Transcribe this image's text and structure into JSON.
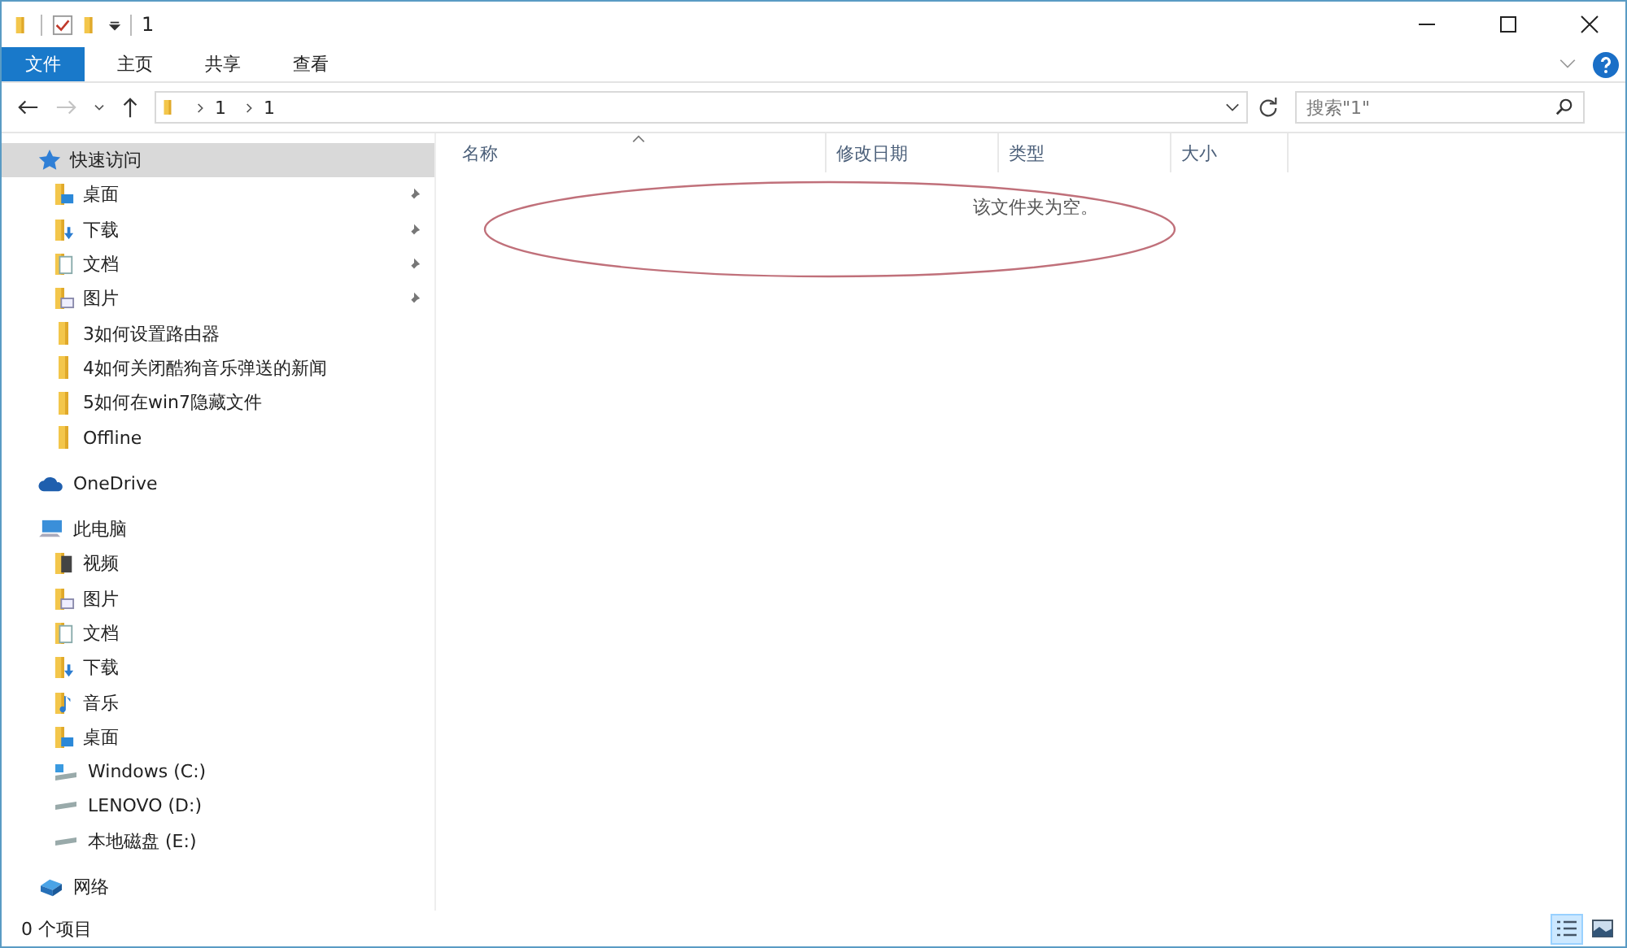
{
  "window": {
    "title": "1"
  },
  "ribbon": {
    "tabs": [
      {
        "label": "文件",
        "kind": "file"
      },
      {
        "label": "主页",
        "kind": "tab"
      },
      {
        "label": "共享",
        "kind": "tab"
      },
      {
        "label": "查看",
        "kind": "tab"
      }
    ]
  },
  "navigation": {
    "forward_disabled": true,
    "path": [
      "1",
      "1"
    ],
    "search": {
      "placeholder": "搜索\"1\""
    }
  },
  "sidebar": {
    "items": [
      {
        "label": "快速访问",
        "kind": "star",
        "selected": true,
        "children": [
          {
            "label": "桌面",
            "kind": "desktop",
            "pinned": true,
            "selected": false
          },
          {
            "label": "下载",
            "kind": "download",
            "pinned": true,
            "selected": false
          },
          {
            "label": "文档",
            "kind": "document",
            "pinned": true,
            "selected": false
          },
          {
            "label": "图片",
            "kind": "pictures",
            "pinned": true,
            "selected": false
          },
          {
            "label": "3如何设置路由器",
            "kind": "folder",
            "pinned": false,
            "selected": false
          },
          {
            "label": "4如何关闭酷狗音乐弹送的新闻",
            "kind": "folder",
            "pinned": false,
            "selected": false
          },
          {
            "label": "5如何在win7隐藏文件",
            "kind": "folder",
            "pinned": false,
            "selected": false
          },
          {
            "label": "Offline",
            "kind": "folder",
            "pinned": false,
            "selected": false
          }
        ]
      },
      {
        "label": "OneDrive",
        "kind": "cloud",
        "selected": false
      },
      {
        "label": "此电脑",
        "kind": "computer",
        "selected": false,
        "children": [
          {
            "label": "视频",
            "kind": "video",
            "pinned": false,
            "selected": false
          },
          {
            "label": "图片",
            "kind": "pictures",
            "pinned": false,
            "selected": false
          },
          {
            "label": "文档",
            "kind": "document",
            "pinned": false,
            "selected": false
          },
          {
            "label": "下载",
            "kind": "download",
            "pinned": false,
            "selected": false
          },
          {
            "label": "音乐",
            "kind": "music",
            "pinned": false,
            "selected": false
          },
          {
            "label": "桌面",
            "kind": "desktop",
            "pinned": false,
            "selected": false
          },
          {
            "label": "Windows (C:)",
            "kind": "system-drive",
            "pinned": false,
            "selected": false
          },
          {
            "label": "LENOVO (D:)",
            "kind": "drive",
            "pinned": false,
            "selected": false
          },
          {
            "label": "本地磁盘 (E:)",
            "kind": "drive",
            "pinned": false,
            "selected": false
          }
        ]
      },
      {
        "label": "网络",
        "kind": "network",
        "selected": false
      }
    ]
  },
  "file_list": {
    "columns": [
      {
        "label": "名称",
        "sorted": true
      },
      {
        "label": "修改日期",
        "sorted": false
      },
      {
        "label": "类型",
        "sorted": false
      },
      {
        "label": "大小",
        "sorted": false
      }
    ],
    "empty_message": "该文件夹为空。"
  },
  "status_bar": {
    "text": "0 个项目",
    "views": [
      {
        "kind": "details",
        "selected": true
      },
      {
        "kind": "large-icons",
        "selected": false
      }
    ]
  }
}
